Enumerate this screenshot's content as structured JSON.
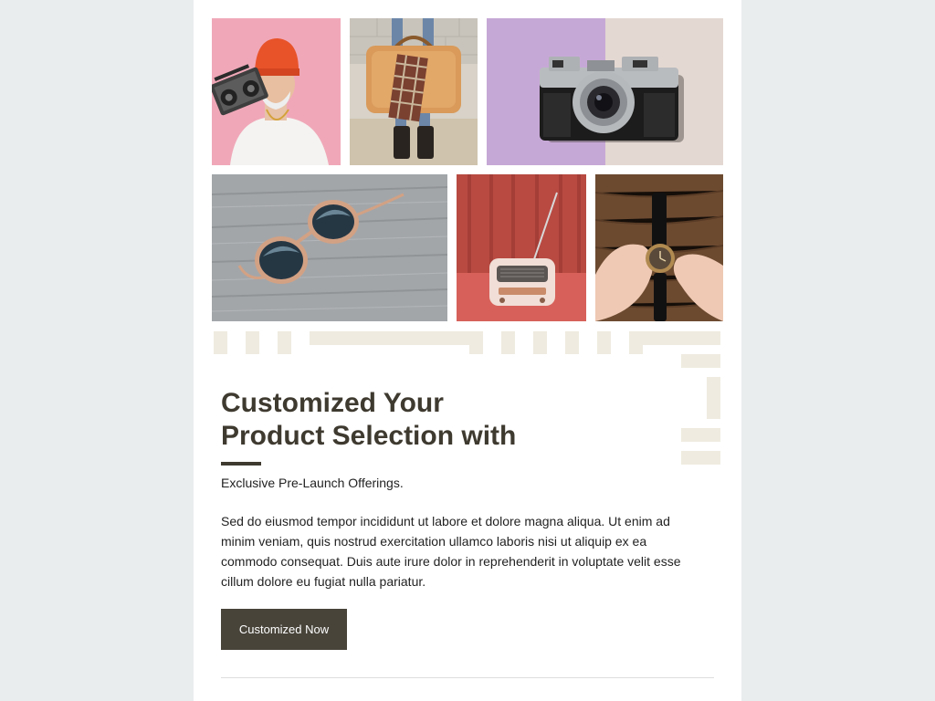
{
  "gallery": {
    "row1": [
      {
        "name": "man-with-boombox-photo",
        "label": "man with boombox"
      },
      {
        "name": "bag-photo",
        "label": "leather bag"
      },
      {
        "name": "camera-photo",
        "label": "vintage camera"
      }
    ],
    "row2": [
      {
        "name": "sunglasses-photo",
        "label": "sunglasses"
      },
      {
        "name": "radio-photo",
        "label": "retro radio"
      },
      {
        "name": "watch-photo",
        "label": "wrist watch"
      }
    ]
  },
  "hero": {
    "title_line1": "Customized Your",
    "title_line2": "Product Selection with",
    "subtitle": "Exclusive Pre-Launch Offerings.",
    "body": "Sed do eiusmod tempor incididunt ut labore et dolore magna aliqua. Ut enim ad minim veniam, quis nostrud exercitation ullamco laboris nisi ut aliquip ex ea commodo consequat. Duis aute irure dolor in reprehenderit in voluptate velit esse cillum dolore eu fugiat nulla pariatur.",
    "cta_label": "Customized Now"
  },
  "colors": {
    "background": "#e9edee",
    "card": "#ffffff",
    "heading": "#3f3a30",
    "button": "#48443a",
    "decoration": "#efebe0"
  }
}
